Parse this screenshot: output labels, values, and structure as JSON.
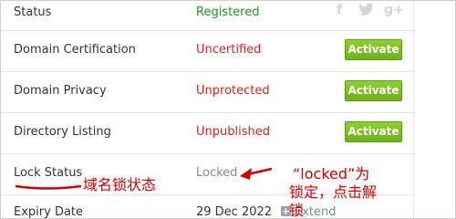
{
  "rows": [
    {
      "label": "Status",
      "value": "Registered",
      "value_color": "#1a9a1a",
      "button": ""
    },
    {
      "label": "Domain Certification",
      "value": "Uncertified",
      "value_color": "#e02020",
      "button": "Activate"
    },
    {
      "label": "Domain Privacy",
      "value": "Unprotected",
      "value_color": "#e02020",
      "button": "Activate"
    },
    {
      "label": "Directory Listing",
      "value": "Unpublished",
      "value_color": "#e02020",
      "button": "Activate"
    },
    {
      "label": "Lock Status",
      "value": "Locked",
      "value_color": "#7a8a99",
      "button": ""
    },
    {
      "label": "Expiry Date",
      "value": "29 Dec 2022",
      "value_color": "#333333",
      "button": ""
    }
  ],
  "extend_label": "Extend",
  "social": {
    "facebook": "f",
    "twitter": "t",
    "googleplus": "g+"
  },
  "annotations": {
    "lock_status_note": "域名锁状态",
    "locked_note_line1": "“locked”为",
    "locked_note_line2": "锁定，点击解",
    "locked_note_line3": "锁"
  },
  "colors": {
    "accent_green": "#7cc121",
    "annotation_red": "#d10000"
  }
}
